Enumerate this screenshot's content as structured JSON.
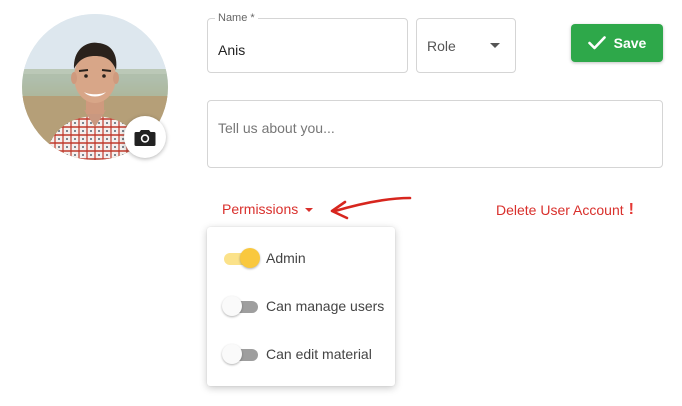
{
  "profile": {
    "avatar_alt": "User profile photo",
    "camera_icon": "camera-icon"
  },
  "form": {
    "name_label": "Name *",
    "name_value": "Anis",
    "role_value": "Role",
    "about_placeholder": "Tell us about you..."
  },
  "toolbar": {
    "save_label": "Save",
    "save_icon": "check-icon"
  },
  "permissions": {
    "button_label": "Permissions",
    "items": [
      {
        "label": "Admin",
        "enabled": true
      },
      {
        "label": "Can manage users",
        "enabled": false
      },
      {
        "label": "Can edit material",
        "enabled": false
      }
    ]
  },
  "danger": {
    "delete_label": "Delete User Account",
    "delete_icon": "exclamation-icon"
  },
  "colors": {
    "accent_red": "#d9302c",
    "save_green": "#2ea84a",
    "toggle_on": "#f9c83e",
    "toggle_on_track": "#fbe28a",
    "toggle_off_track": "#9e9e9e"
  }
}
